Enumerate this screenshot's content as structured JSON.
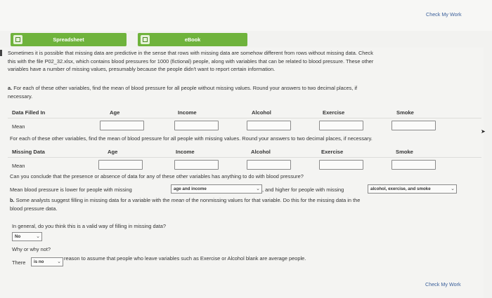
{
  "header": {
    "check_my_work": "Check My Work"
  },
  "tabs": {
    "spreadsheet": "Spreadsheet",
    "ebook": "eBook"
  },
  "intro": {
    "line1": "Sometimes it is possible that missing data are predictive in the sense that rows with missing data are somehow different from rows without missing data. Check",
    "line2": "this with the file P02_32.xlsx, which contains blood pressures for 1000 (fictional) people, along with variables that can be related to blood pressure. These other",
    "line3": "variables have a number of missing values, presumably because the people didn't want to report certain information."
  },
  "part_a": {
    "letter": "a.",
    "line1": "For each of these other variables, find the mean of blood pressure for all people without missing values. Round your answers to two decimal places, if",
    "line2": "necessary."
  },
  "table1": {
    "row_header": "Data Filled In",
    "columns": [
      "Age",
      "Income",
      "Alcohol",
      "Exercise",
      "Smoke"
    ],
    "row_label": "Mean"
  },
  "missing_prompt": "For each of these other variables, find the mean of blood pressure for all people with missing values. Round your answers to two decimal places, if necessary.",
  "table2": {
    "row_header": "Missing Data",
    "columns": [
      "Age",
      "Income",
      "Alcohol",
      "Exercise",
      "Smoke"
    ],
    "row_label": "Mean"
  },
  "conclude_question": "Can you conclude that the presence or absence of data for any of these other variables has anything to do with blood pressure?",
  "conclusion": {
    "prefix": "Mean blood pressure is lower for people with missing",
    "select1": "age and income",
    "middle": ", and higher for people with missing",
    "select2": "alcohol, exercise, and smoke"
  },
  "part_b": {
    "letter": "b.",
    "line1_a": "Some analysts suggest filling in missing data for a variable with the",
    "line1_em": "mean",
    "line1_b": "of the nonmissing values for that variable. Do this for the missing data in the",
    "line2": "blood pressure data."
  },
  "valid_question": "In general, do you think this is a valid way of filling in missing data?",
  "valid_answer": "No",
  "why_question": "Why or why not?",
  "why": {
    "prefix": "There",
    "select": "is no",
    "suffix": "reason to assume that people who leave variables such as Exercise or Alcohol blank are average people."
  }
}
